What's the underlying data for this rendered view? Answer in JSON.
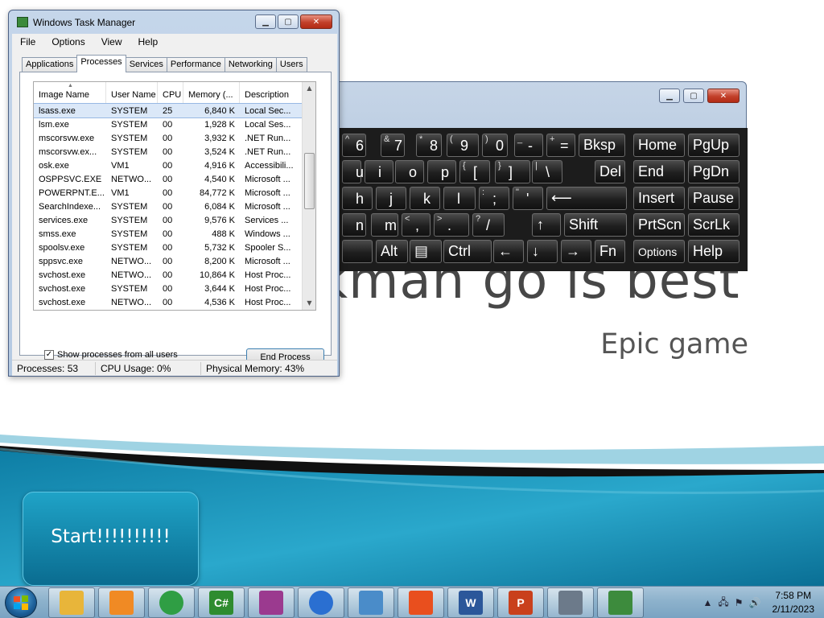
{
  "slide": {
    "title_visible": "kman go is best",
    "subtitle": "Epic game",
    "start_button": "Start!!!!!!!!!!"
  },
  "keyboard": {
    "rows": [
      [
        {
          "sm": "^",
          "main": "6"
        },
        {
          "sm": "&",
          "main": "7"
        },
        {
          "sm": "*",
          "main": "8"
        },
        {
          "sm": "(",
          "main": "9"
        },
        {
          "sm": ")",
          "main": "0"
        },
        {
          "sm": "_",
          "main": "-"
        },
        {
          "sm": "+",
          "main": "="
        },
        {
          "label": "Bksp"
        },
        {
          "label": "Home"
        },
        {
          "label": "PgUp"
        }
      ],
      [
        {
          "main": "u"
        },
        {
          "main": "i"
        },
        {
          "main": "o"
        },
        {
          "main": "p"
        },
        {
          "sm": "{",
          "main": "["
        },
        {
          "sm": "}",
          "main": "]"
        },
        {
          "sm": "|",
          "main": "\\"
        },
        {
          "label": "Del"
        },
        {
          "label": "End"
        },
        {
          "label": "PgDn"
        }
      ],
      [
        {
          "main": "h"
        },
        {
          "main": "j"
        },
        {
          "main": "k"
        },
        {
          "main": "l"
        },
        {
          "sm": ":",
          "main": ";"
        },
        {
          "sm": "\"",
          "main": "'"
        },
        {
          "label": "⟵"
        },
        {
          "label": "Insert"
        },
        {
          "label": "Pause"
        }
      ],
      [
        {
          "main": "n"
        },
        {
          "main": "m"
        },
        {
          "sm": "<",
          "main": ","
        },
        {
          "sm": ">",
          "main": "."
        },
        {
          "sm": "?",
          "main": "/"
        },
        {
          "label": "↑"
        },
        {
          "label": "Shift"
        },
        {
          "label": "PrtScn"
        },
        {
          "label": "ScrLk"
        }
      ],
      [
        {
          "label": ""
        },
        {
          "label": "Alt"
        },
        {
          "label": "▤"
        },
        {
          "label": "Ctrl"
        },
        {
          "label": "←"
        },
        {
          "label": "↓"
        },
        {
          "label": "→"
        },
        {
          "label": "Fn"
        },
        {
          "label": "Options"
        },
        {
          "label": "Help"
        }
      ]
    ]
  },
  "task_manager": {
    "title": "Windows Task Manager",
    "menu": [
      "File",
      "Options",
      "View",
      "Help"
    ],
    "tabs": [
      "Applications",
      "Processes",
      "Services",
      "Performance",
      "Networking",
      "Users"
    ],
    "active_tab": "Processes",
    "columns": [
      "Image Name",
      "User Name",
      "CPU",
      "Memory (...",
      "Description"
    ],
    "rows": [
      [
        "lsass.exe",
        "SYSTEM",
        "25",
        "6,840 K",
        "Local Sec..."
      ],
      [
        "lsm.exe",
        "SYSTEM",
        "00",
        "1,928 K",
        "Local Ses..."
      ],
      [
        "mscorsvw.exe",
        "SYSTEM",
        "00",
        "3,932 K",
        ".NET Run..."
      ],
      [
        "mscorsvw.ex...",
        "SYSTEM",
        "00",
        "3,524 K",
        ".NET Run..."
      ],
      [
        "osk.exe",
        "VM1",
        "00",
        "4,916 K",
        "Accessibili..."
      ],
      [
        "OSPPSVC.EXE",
        "NETWO...",
        "00",
        "4,540 K",
        "Microsoft ..."
      ],
      [
        "POWERPNT.E...",
        "VM1",
        "00",
        "84,772 K",
        "Microsoft ..."
      ],
      [
        "SearchIndexe...",
        "SYSTEM",
        "00",
        "6,084 K",
        "Microsoft ..."
      ],
      [
        "services.exe",
        "SYSTEM",
        "00",
        "9,576 K",
        "Services ..."
      ],
      [
        "smss.exe",
        "SYSTEM",
        "00",
        "488 K",
        "Windows ..."
      ],
      [
        "spoolsv.exe",
        "SYSTEM",
        "00",
        "5,732 K",
        "Spooler S..."
      ],
      [
        "sppsvc.exe",
        "NETWO...",
        "00",
        "8,200 K",
        "Microsoft ..."
      ],
      [
        "svchost.exe",
        "NETWO...",
        "00",
        "10,864 K",
        "Host Proc..."
      ],
      [
        "svchost.exe",
        "SYSTEM",
        "00",
        "3,644 K",
        "Host Proc..."
      ],
      [
        "svchost.exe",
        "NETWO...",
        "00",
        "4,536 K",
        "Host Proc..."
      ]
    ],
    "show_all_label": "Show processes from all users",
    "show_all_checked": true,
    "end_process_label": "End Process",
    "status": {
      "processes": "Processes: 53",
      "cpu": "CPU Usage: 0%",
      "memory": "Physical Memory: 43%"
    }
  },
  "taskbar": {
    "items": [
      {
        "icon": "explorer-icon",
        "color": "#e8b53a"
      },
      {
        "icon": "media-player-icon",
        "color": "#f08a24"
      },
      {
        "icon": "chrome-icon",
        "color": "#2f9e44"
      },
      {
        "icon": "csharp-icon",
        "label": "C#",
        "color": "#2f8c2f"
      },
      {
        "icon": "winrar-icon",
        "color": "#9b3a8f"
      },
      {
        "icon": "chromium-lock-icon",
        "color": "#2a6fd1"
      },
      {
        "icon": "control-panel-icon",
        "color": "#4a8cc9"
      },
      {
        "icon": "windows-icon",
        "color": "#e94f1e"
      },
      {
        "icon": "word-icon",
        "label": "W",
        "color": "#2b579a"
      },
      {
        "icon": "powerpoint-icon",
        "label": "P",
        "color": "#c9401c"
      },
      {
        "icon": "on-screen-keyboard-icon",
        "color": "#6c7a8a"
      },
      {
        "icon": "task-manager-icon",
        "color": "#3d8b3d"
      }
    ],
    "clock_time": "7:58 PM",
    "clock_date": "2/11/2023"
  }
}
